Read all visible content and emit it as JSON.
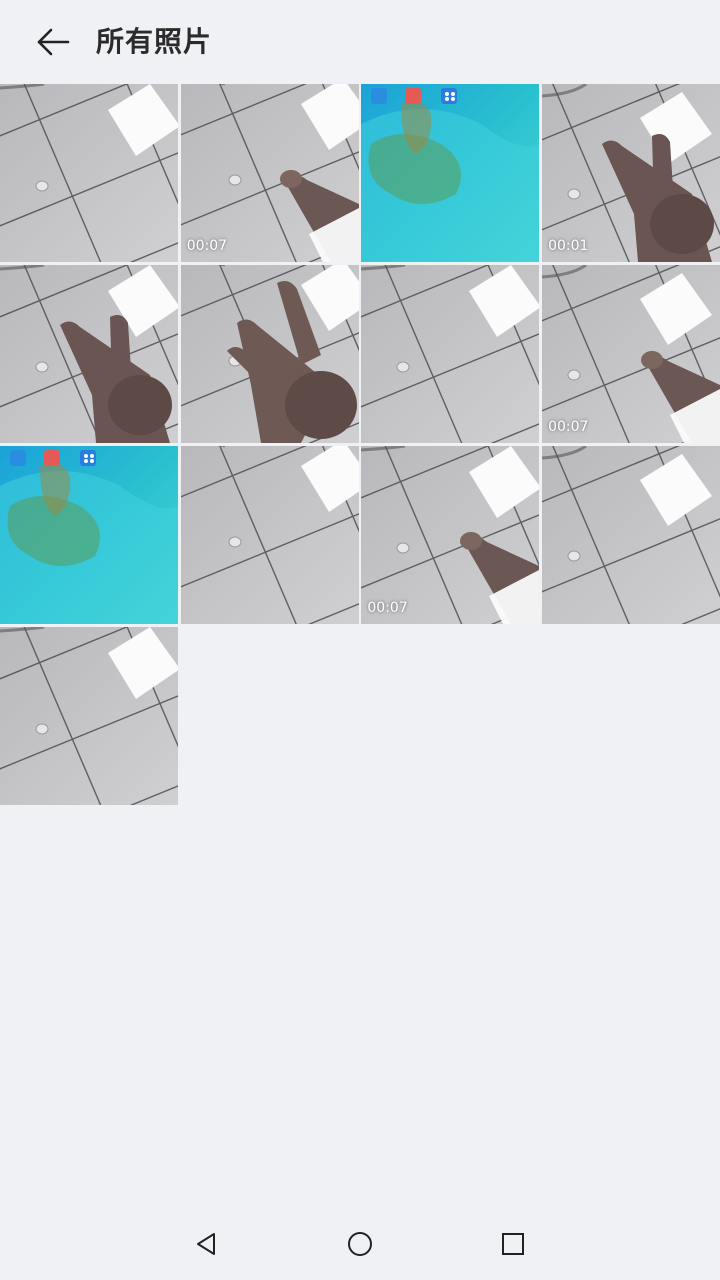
{
  "header": {
    "title": "所有照片",
    "back_icon": "arrow-left-icon"
  },
  "photos": [
    {
      "kind": "floor",
      "variant": "a",
      "duration": ""
    },
    {
      "kind": "finger",
      "variant": "b",
      "duration": "00:07"
    },
    {
      "kind": "screen",
      "variant": "a",
      "duration": ""
    },
    {
      "kind": "peace",
      "variant": "c",
      "duration": "00:01"
    },
    {
      "kind": "peace",
      "variant": "a",
      "duration": ""
    },
    {
      "kind": "three",
      "variant": "b",
      "duration": ""
    },
    {
      "kind": "floor",
      "variant": "a",
      "duration": ""
    },
    {
      "kind": "finger",
      "variant": "c",
      "duration": "00:07"
    },
    {
      "kind": "screen",
      "variant": "b",
      "duration": ""
    },
    {
      "kind": "floor",
      "variant": "b",
      "duration": ""
    },
    {
      "kind": "finger",
      "variant": "a",
      "duration": "00:07"
    },
    {
      "kind": "floor",
      "variant": "c",
      "duration": ""
    },
    {
      "kind": "floor",
      "variant": "a",
      "duration": ""
    }
  ],
  "navbar": {
    "back_icon": "triangle-back-icon",
    "home_icon": "circle-home-icon",
    "recents_icon": "square-recents-icon"
  },
  "colors": {
    "background": "#f0f1f4",
    "title": "#2b2b2b",
    "floor": "#c9c9cb",
    "skin": "#6e5a55",
    "screen_teal": "#2fc6d6"
  }
}
